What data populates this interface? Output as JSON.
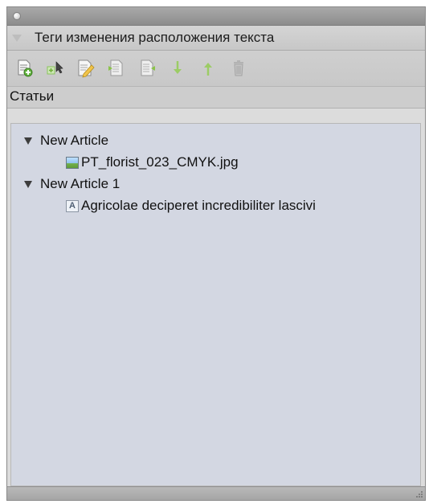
{
  "header": {
    "title": "Теги изменения расположения текста"
  },
  "toolbar": {
    "buttons": [
      {
        "icon": "new-article-icon"
      },
      {
        "icon": "add-to-article-icon"
      },
      {
        "icon": "edit-article-icon"
      },
      {
        "icon": "move-into-article-icon"
      },
      {
        "icon": "move-out-of-article-icon"
      },
      {
        "icon": "move-down-icon"
      },
      {
        "icon": "move-up-icon"
      },
      {
        "icon": "delete-icon"
      }
    ]
  },
  "section": {
    "label": "Статьи"
  },
  "tree": {
    "items": [
      {
        "label": "New Article",
        "children": [
          {
            "label": "PT_florist_023_CMYK.jpg",
            "kind": "image"
          }
        ]
      },
      {
        "label": "New Article 1",
        "children": [
          {
            "label": "Agricolae deciperet incredibiliter lascivi",
            "kind": "text",
            "icon_glyph": "A"
          }
        ]
      }
    ]
  },
  "colors": {
    "tree_background": "#d3d7e2",
    "panel_background": "#dcdcdc",
    "toolbar_icon_green": "#8bc34a",
    "toolbar_icon_gray": "#a6a6a6"
  }
}
